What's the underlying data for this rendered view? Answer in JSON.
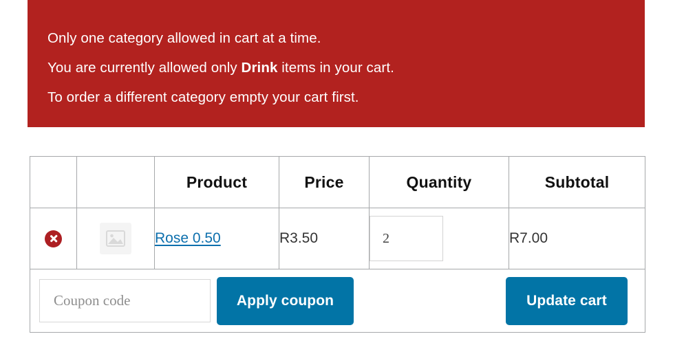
{
  "notice": {
    "lines": [
      "Only one category allowed in cart at a time.",
      "",
      "To order a different category empty your cart first."
    ],
    "line2_before": "You are currently allowed only ",
    "line2_bold": "Drink",
    "line2_after": " items in your cart.",
    "background_color": "#b2221f",
    "text_color": "#ffffff"
  },
  "cart": {
    "headers": {
      "remove": "",
      "thumbnail": "",
      "product": "Product",
      "price": "Price",
      "quantity": "Quantity",
      "subtotal": "Subtotal"
    },
    "rows": [
      {
        "remove_label": "×",
        "thumbnail_icon": "image-placeholder-icon",
        "product_name": "Rose 0.50",
        "price": "R3.50",
        "quantity": "2",
        "subtotal": "R7.00"
      }
    ]
  },
  "actions": {
    "coupon_placeholder": "Coupon code",
    "coupon_value": "",
    "apply_coupon_label": "Apply coupon",
    "update_cart_label": "Update cart",
    "button_color": "#0274a6",
    "link_color": "#0c6fad"
  }
}
